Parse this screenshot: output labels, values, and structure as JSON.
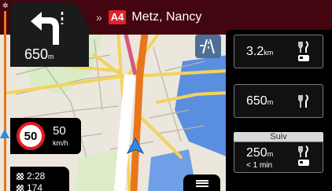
{
  "next_road": {
    "badge": "A4",
    "name": "Metz, Nancy"
  },
  "turn": {
    "distance": "650",
    "unit": "m",
    "icon": "keep-left-icon"
  },
  "speed": {
    "limit": "50",
    "current": "50",
    "unit": "km/h"
  },
  "eta": {
    "time": "2:28",
    "distance": "174"
  },
  "poi_panel": {
    "items": [
      {
        "distance": "3.2",
        "unit": "km",
        "icons": [
          "restaurant-icon",
          "fuel-icon"
        ]
      },
      {
        "distance": "650",
        "unit": "m",
        "icons": [
          "restaurant-icon"
        ]
      },
      {
        "distance": "250",
        "unit": "m",
        "sub": "< 1 min",
        "icons": [
          "restaurant-icon",
          "fuel-icon"
        ]
      }
    ],
    "header": "Suiv"
  },
  "colors": {
    "banner": "#43050f",
    "route": "#e8761c",
    "position": "#2a8de4",
    "water": "#5a8fe0"
  }
}
